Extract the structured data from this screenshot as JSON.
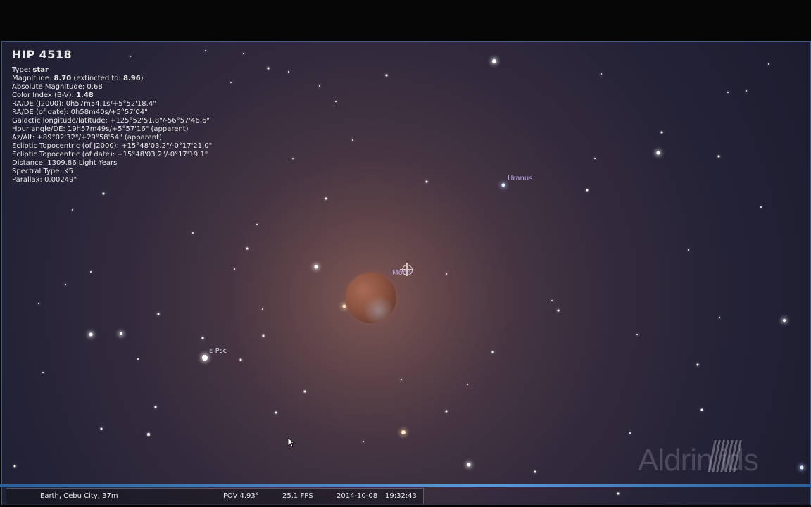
{
  "object_info": {
    "title": "HIP 4518",
    "type_label": "Type:",
    "type_value": "star",
    "magnitude_label": "Magnitude:",
    "magnitude_value": "8.70",
    "magnitude_extinct_prefix": "(extincted to:",
    "magnitude_extinct_value": "8.96",
    "magnitude_extinct_suffix": ")",
    "absolute_magnitude": "Absolute Magnitude: 0.68",
    "color_index_label": "Color Index (B-V):",
    "color_index_value": "1.48",
    "radec_j2000": "RA/DE (J2000): 0h57m54.1s/+5°52'18.4\"",
    "radec_date": "RA/DE (of date): 0h58m40s/+5°57'04\"",
    "galactic": "Galactic longitude/latitude: +125°52'51.8\"/-56°57'46.6\"",
    "hour_angle": "Hour angle/DE: 19h57m49s/+5°57'16\" (apparent)",
    "azalt": "Az/Alt: +89°02'32\"/+29°58'54\" (apparent)",
    "ecliptic_j2000": "Ecliptic Topocentric (of J2000): +15°48'03.2\"/-0°17'21.0\"",
    "ecliptic_date": "Ecliptic Topocentric (of date): +15°48'03.2\"/-0°17'19.1\"",
    "distance": "Distance: 1309.86 Light Years",
    "spectral_type": "Spectral Type: K5",
    "parallax": "Parallax: 0.00249\""
  },
  "sky_labels": {
    "uranus": "Uranus",
    "moon": "Moon",
    "eps_psc": "ε Psc"
  },
  "watermark": "Aldrin ids",
  "statusbar": {
    "location": "Earth, Cebu City, 37m",
    "fov": "FOV 4.93°",
    "fps": "25.1 FPS",
    "date": "2014-10-08",
    "time": "19:32:43"
  },
  "colors": {
    "sky_dark": "#1a1a2c",
    "sky_glow": "#875c58",
    "label_planet": "#b9a6e6",
    "window_edge": "#3a5a86"
  }
}
